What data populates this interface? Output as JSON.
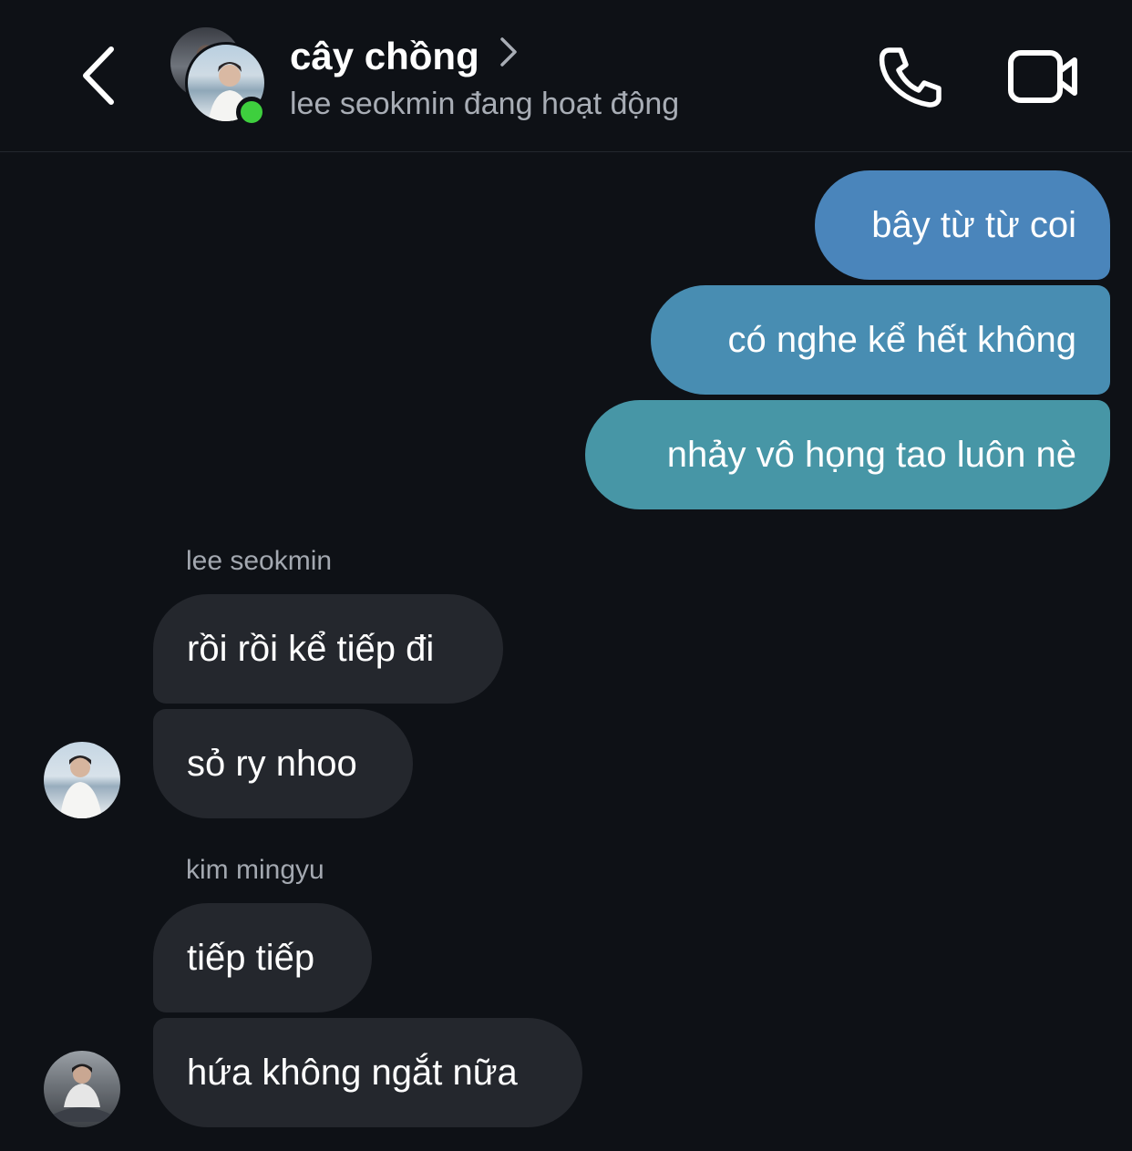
{
  "header": {
    "title": "cây chồng",
    "subtitle": "lee seokmin đang hoạt động",
    "back_icon": "chevron-left-icon",
    "call_icon": "phone-icon",
    "video_icon": "video-camera-icon",
    "presence": "online"
  },
  "colors": {
    "background": "#0e1116",
    "outgoing_top": "#4a85bb",
    "outgoing_bottom": "#4796a6",
    "incoming": "#24272d",
    "presence_green": "#3ecf3e"
  },
  "messages": {
    "outgoing": [
      {
        "text": "bây từ từ coi"
      },
      {
        "text": "có nghe kể hết không"
      },
      {
        "text": "nhảy vô họng tao luôn nè"
      }
    ],
    "group1": {
      "sender": "lee seokmin",
      "items": [
        {
          "text": "rồi rồi kể tiếp đi"
        },
        {
          "text": "sỏ ry nhoo"
        }
      ]
    },
    "group2": {
      "sender": "kim mingyu",
      "items": [
        {
          "text": "tiếp tiếp"
        },
        {
          "text": "hứa không ngắt nữa"
        }
      ]
    }
  }
}
